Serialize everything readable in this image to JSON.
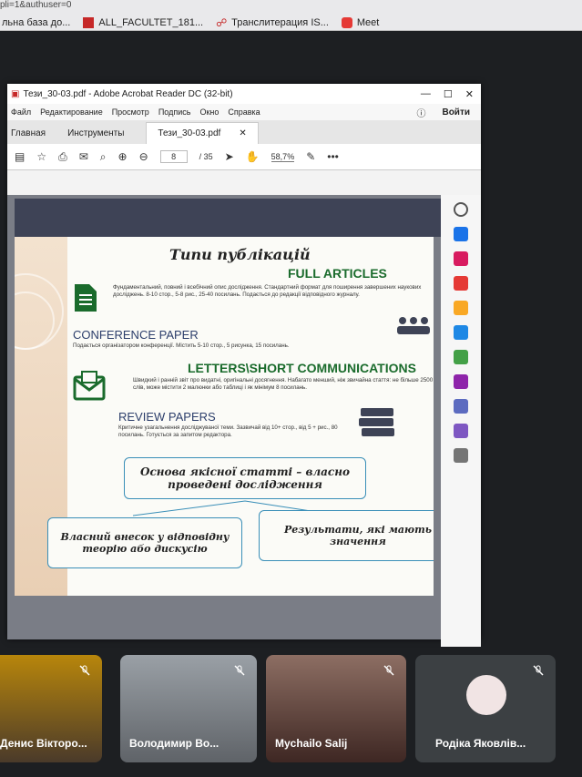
{
  "browser": {
    "url_fragment": "pli=1&authuser=0",
    "bookmarks": [
      {
        "label": "льна база до...",
        "icon": "bookmark-icon"
      },
      {
        "label": "ALL_FACULTET_181...",
        "icon": "pdf-icon"
      },
      {
        "label": "Транслитерация IS...",
        "icon": "translit-icon"
      },
      {
        "label": "Meet",
        "icon": "youtube-icon"
      }
    ]
  },
  "acrobat": {
    "window_title": "Тези_30-03.pdf - Adobe Acrobat Reader DC (32-bit)",
    "menu": [
      "Файл",
      "Редактирование",
      "Просмотр",
      "Подпись",
      "Окно",
      "Справка"
    ],
    "login": "Войти",
    "tabs": {
      "home": "Главная",
      "tools": "Инструменты",
      "doc": "Тези_30-03.pdf"
    },
    "page_current": "8",
    "page_total": "/ 35",
    "zoom": "58,7%"
  },
  "slide": {
    "title": "Типи публікацій",
    "full_articles": {
      "heading": "FULL ARTICLES",
      "text": "Фундаментальний, повний і всебічний опис дослідження. Стандартний формат для поширення завершених наукових досліджень. 8-10 стор., 5-8 рис., 25-40 посилань. Подається до редакції відповідного журналу."
    },
    "conference": {
      "heading": "Conference paper",
      "text": "Подається організатором конференції. Містить 5-10 стор., 5 рисунка, 15 посилань."
    },
    "letters": {
      "heading": "LETTERS\\SHORT COMMUNICATIONS",
      "text": "Швидкий і ранній звіт про видатні, оригінальні досягнення. Набагато менший, ніж звичайна стаття: не більше 2500 слів, може містити 2 малюнки або таблиці і як мінімум 8 посилань."
    },
    "review": {
      "heading": "Review papers",
      "text": "Критичне узагальнення досліджуваної теми. Зазвичай від 10+ стор., від 5 + рис., 80 посилань. Готується за запитом редактора."
    },
    "center_box": "Основа якісної статті – власно проведені дослідження",
    "left_box": "Власний внесок у відповідну теорію або дискусію",
    "right_box": "Результати, які мають значення"
  },
  "participants": [
    {
      "name": "Денис Вікторо...",
      "muted": true
    },
    {
      "name": "Володимир Во...",
      "muted": true
    },
    {
      "name": "Mychailo Salij",
      "muted": true
    },
    {
      "name": "Родіка Яковлів...",
      "muted": true
    }
  ],
  "colors": {
    "accent_green": "#1a6b2c",
    "accent_navy": "#2c3e6b",
    "box_border": "#3a8fb8"
  }
}
